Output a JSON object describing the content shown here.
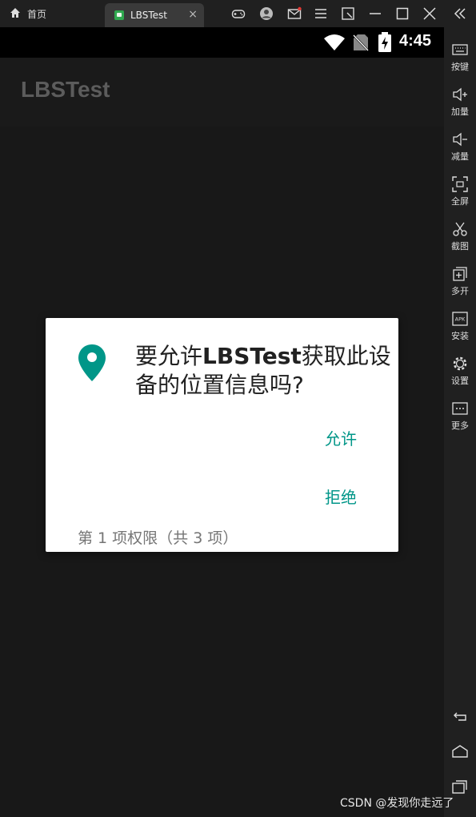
{
  "emulator": {
    "home_tab_label": "首页",
    "app_tab_label": "LBSTest",
    "tab_close": "×"
  },
  "status_bar": {
    "time": "4:45"
  },
  "app": {
    "title": "LBSTest"
  },
  "dialog": {
    "message_prefix": "要允许",
    "app_name": "LBSTest",
    "message_suffix": "获取此设备的位置信息吗?",
    "allow_label": "允许",
    "deny_label": "拒绝",
    "counter": "第 1 项权限（共 3 项）",
    "accent_color": "#009688"
  },
  "sidebar": {
    "items": [
      {
        "label": "按键",
        "icon": "keyboard-icon"
      },
      {
        "label": "加量",
        "icon": "volume-up-icon"
      },
      {
        "label": "减量",
        "icon": "volume-down-icon"
      },
      {
        "label": "全屏",
        "icon": "fullscreen-icon"
      },
      {
        "label": "截图",
        "icon": "scissors-icon"
      },
      {
        "label": "多开",
        "icon": "multi-instance-icon"
      },
      {
        "label": "安装",
        "icon": "apk-icon"
      },
      {
        "label": "设置",
        "icon": "gear-icon"
      },
      {
        "label": "更多",
        "icon": "more-icon"
      }
    ]
  },
  "watermark": "CSDN @发现你走远了"
}
